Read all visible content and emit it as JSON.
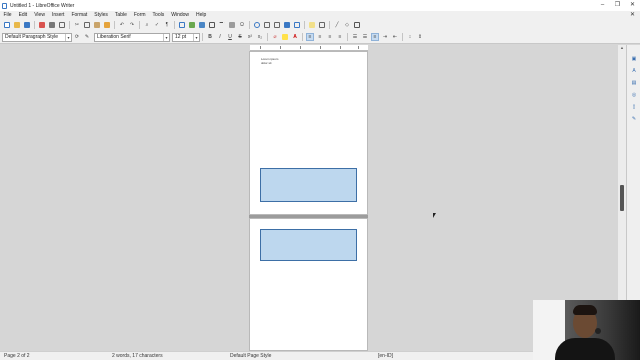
{
  "window": {
    "title": "Untitled 1 - LibreOffice Writer",
    "controls": [
      "–",
      "❐",
      "✕"
    ]
  },
  "menubar": {
    "items": [
      "File",
      "Edit",
      "View",
      "Insert",
      "Format",
      "Styles",
      "Table",
      "Form",
      "Tools",
      "Window",
      "Help"
    ],
    "close_document": "✕"
  },
  "toolbar_standard": {
    "icons": [
      "new-icon",
      "open-icon",
      "save-icon",
      "export-pdf-icon",
      "print-icon",
      "print-preview-icon",
      "cut-icon",
      "copy-icon",
      "paste-icon",
      "clone-formatting-icon",
      "undo-icon",
      "redo-icon",
      "find-replace-icon",
      "spelling-icon",
      "formatting-marks-icon",
      "table-icon",
      "image-icon",
      "chart-icon",
      "text-box-icon",
      "page-break-icon",
      "field-icon",
      "special-character-icon",
      "hyperlink-icon",
      "footnote-icon",
      "endnote-icon",
      "bookmark-icon",
      "cross-reference-icon",
      "comment-icon",
      "track-changes-icon",
      "line-icon",
      "basic-shapes-icon",
      "draw-functions-icon"
    ]
  },
  "toolbar_formatting": {
    "paragraph_style": "Default Paragraph Style",
    "font_name": "Liberation Serif",
    "font_size": "12 pt",
    "bold": "B",
    "italic": "I",
    "underline": "U",
    "strikethrough": "S",
    "superscript": "x²",
    "subscript": "x₂"
  },
  "document": {
    "page1_text": [
      "Lorem ipsum",
      "dolor sit"
    ]
  },
  "statusbar": {
    "page": "Page 2 of 2",
    "words": "2 words, 17 characters",
    "page_style": "Default Page Style",
    "language": "[en-ID]"
  },
  "colors": {
    "frame_fill": "#bdd7ee",
    "frame_border": "#3d6fa6",
    "accent": "#3a78c4"
  }
}
